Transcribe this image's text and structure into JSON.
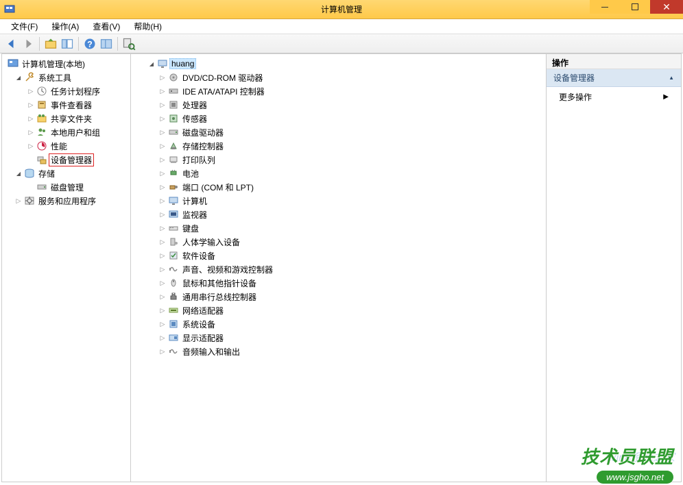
{
  "window": {
    "title": "计算机管理"
  },
  "menubar": {
    "file": "文件(F)",
    "action": "操作(A)",
    "view": "查看(V)",
    "help": "帮助(H)"
  },
  "left_tree": {
    "root": "计算机管理(本地)",
    "system_tools": "系统工具",
    "task_scheduler": "任务计划程序",
    "event_viewer": "事件查看器",
    "shared_folders": "共享文件夹",
    "local_users": "本地用户和组",
    "performance": "性能",
    "device_manager": "设备管理器",
    "storage": "存储",
    "disk_mgmt": "磁盘管理",
    "services": "服务和应用程序"
  },
  "center": {
    "computer_name": "huang",
    "categories": [
      "DVD/CD-ROM 驱动器",
      "IDE ATA/ATAPI 控制器",
      "处理器",
      "传感器",
      "磁盘驱动器",
      "存储控制器",
      "打印队列",
      "电池",
      "端口 (COM 和 LPT)",
      "计算机",
      "监视器",
      "键盘",
      "人体学输入设备",
      "软件设备",
      "声音、视频和游戏控制器",
      "鼠标和其他指针设备",
      "通用串行总线控制器",
      "网络适配器",
      "系统设备",
      "显示适配器",
      "音频输入和输出"
    ]
  },
  "right": {
    "header": "操作",
    "section": "设备管理器",
    "more": "更多操作"
  },
  "watermark": {
    "brand": "技术员联盟",
    "url": "www.jsgho.net",
    "faint": "Win8系统之家"
  }
}
